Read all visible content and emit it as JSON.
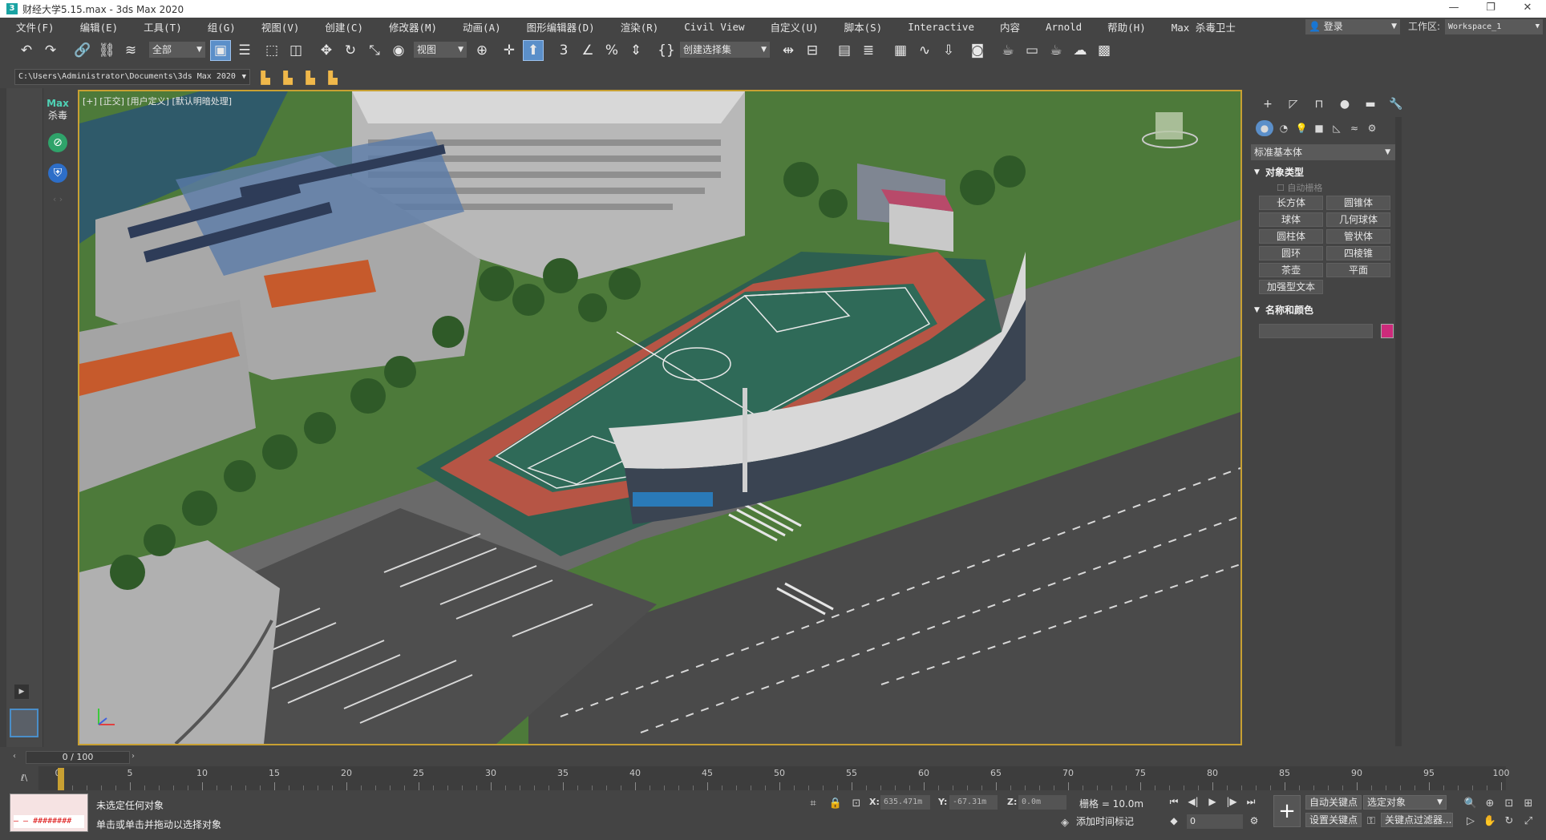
{
  "window": {
    "title": "财经大学5.15.max - 3ds Max 2020",
    "app_icon": "3",
    "controls": [
      "—",
      "❐",
      "✕"
    ]
  },
  "menu": [
    "文件(F)",
    "编辑(E)",
    "工具(T)",
    "组(G)",
    "视图(V)",
    "创建(C)",
    "修改器(M)",
    "动画(A)",
    "图形编辑器(D)",
    "渲染(R)",
    "Civil View",
    "自定义(U)",
    "脚本(S)",
    "Interactive",
    "内容",
    "Arnold",
    "帮助(H)",
    "Max 杀毒卫士"
  ],
  "account": {
    "login_label": "登录",
    "workspace_label": "工作区:",
    "workspace_value": "Workspace_1"
  },
  "toolbar": {
    "selection_filter": "全部",
    "ref_coord": "视图",
    "named_selection": "创建选择集",
    "icons": [
      "undo-icon",
      "redo-icon",
      "link-icon",
      "unlink-icon",
      "bind-spacewarp-icon",
      "select-object-icon",
      "select-by-name-icon",
      "rect-region-icon",
      "window-crossing-icon",
      "move-icon",
      "rotate-icon",
      "scale-icon",
      "placement-icon",
      "pivot-icon",
      "keyboard-override-icon",
      "snap-3d-icon",
      "angle-snap-icon",
      "percent-snap-icon",
      "spinner-snap-icon",
      "edit-named-sel-icon",
      "mirror-icon",
      "align-icon",
      "scene-explorer-icon",
      "layer-explorer-icon",
      "ribbon-icon",
      "curve-editor-icon",
      "schematic-view-icon",
      "material-editor-icon",
      "render-setup-icon",
      "rendered-frame-icon",
      "render-icon",
      "render-cloud-icon",
      "a360-gallery-icon"
    ]
  },
  "project": {
    "path": "C:\\Users\\Administrator\\Documents\\3ds Max 2020"
  },
  "sidebar": {
    "logo_top": "Max",
    "logo_bottom": "杀毒",
    "icons": [
      "shield-green-icon",
      "shield-blue-icon"
    ]
  },
  "viewport": {
    "label": "[+] [正交] [用户定义] [默认明暗处理]",
    "scene_desc_hidden": ""
  },
  "command_panel": {
    "tabs": [
      "create-tab-icon",
      "modify-tab-icon",
      "hierarchy-tab-icon",
      "motion-tab-icon",
      "display-tab-icon",
      "utilities-tab-icon"
    ],
    "subtabs": [
      "geometry-icon",
      "shapes-icon",
      "lights-icon",
      "cameras-icon",
      "helpers-icon",
      "spacewarps-icon",
      "systems-icon"
    ],
    "category": "标准基本体",
    "object_type_title": "对象类型",
    "autogrid": "自动栅格",
    "objects": [
      "长方体",
      "圆锥体",
      "球体",
      "几何球体",
      "圆柱体",
      "管状体",
      "圆环",
      "四棱锥",
      "茶壶",
      "平面",
      "加强型文本"
    ],
    "name_color_title": "名称和颜色",
    "object_color": "#cc2a7b"
  },
  "timeline": {
    "slider": "0 / 100",
    "ticks": [
      0,
      5,
      10,
      15,
      20,
      25,
      30,
      35,
      40,
      45,
      50,
      55,
      60,
      65,
      70,
      75,
      80,
      85,
      90,
      95,
      100
    ]
  },
  "status": {
    "line1": "未选定任何对象",
    "line2": "单击或单击并拖动以选择对象",
    "x_label": "X:",
    "x_value": "635.471m",
    "y_label": "Y:",
    "y_value": "-67.31m",
    "z_label": "Z:",
    "z_value": "0.0m",
    "grid": "栅格 = 10.0m",
    "add_time_tag": "添加时间标记",
    "auto_key": "自动关键点",
    "set_key": "设置关键点",
    "selected_object": "选定对象",
    "key_filters": "关键点过滤器...",
    "frame": "0",
    "maxscript_text": "— — ########"
  }
}
